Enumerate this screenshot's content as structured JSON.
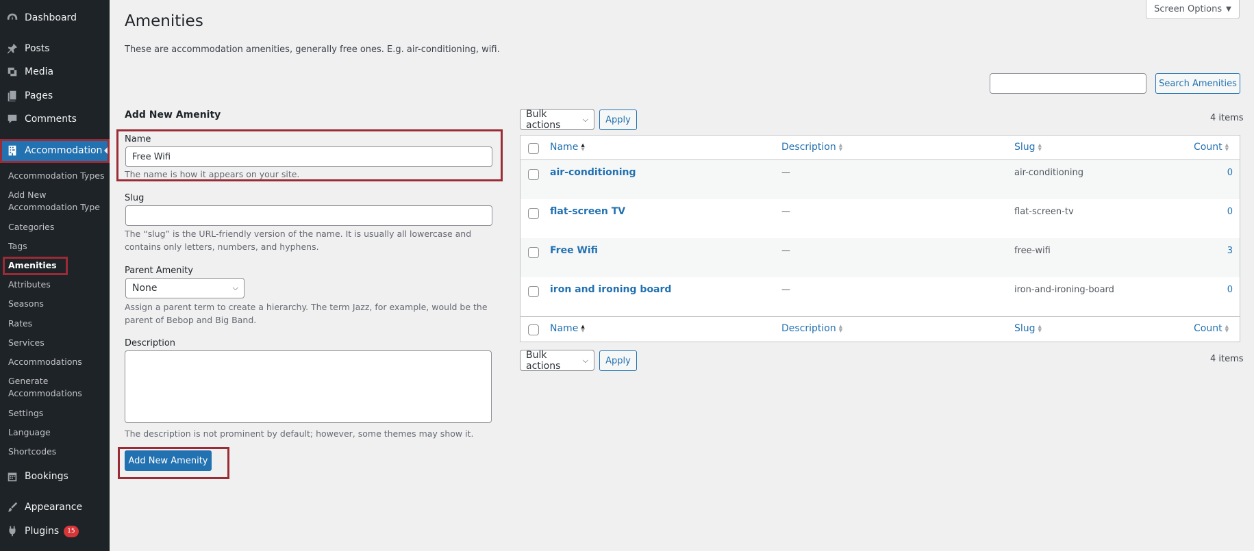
{
  "sidebar": {
    "menu": [
      {
        "label": "Dashboard",
        "icon": "dashboard-icon"
      },
      {
        "label": "Posts",
        "icon": "pin-icon"
      },
      {
        "label": "Media",
        "icon": "media-icon"
      },
      {
        "label": "Pages",
        "icon": "pages-icon"
      },
      {
        "label": "Comments",
        "icon": "comment-icon"
      },
      {
        "label": "Accommodation",
        "icon": "building-icon"
      }
    ],
    "submenu": [
      "Accommodation Types",
      "Add New\nAccommodation Type",
      "Categories",
      "Tags",
      "Amenities",
      "Attributes",
      "Seasons",
      "Rates",
      "Services",
      "Accommodations",
      "Generate\nAccommodations",
      "Settings",
      "Language",
      "Shortcodes"
    ],
    "bottom_menu": [
      {
        "label": "Bookings",
        "icon": "calendar-icon"
      },
      {
        "label": "Appearance",
        "icon": "brush-icon"
      },
      {
        "label": "Plugins",
        "icon": "plugin-icon",
        "badge": "15"
      }
    ]
  },
  "header": {
    "title": "Amenities",
    "description": "These are accommodation amenities, generally free ones. E.g. air-conditioning, wifi.",
    "screen_options": "Screen Options"
  },
  "search": {
    "value": "",
    "button": "Search Amenities"
  },
  "form": {
    "heading": "Add New Amenity",
    "name_label": "Name",
    "name_value": "Free Wifi",
    "name_help": "The name is how it appears on your site.",
    "slug_label": "Slug",
    "slug_value": "",
    "slug_help": "The “slug” is the URL-friendly version of the name. It is usually all lowercase and contains only letters, numbers, and hyphens.",
    "parent_label": "Parent Amenity",
    "parent_value": "None",
    "parent_help": "Assign a parent term to create a hierarchy. The term Jazz, for example, would be the parent of Bebop and Big Band.",
    "description_label": "Description",
    "description_value": "",
    "description_help": "The description is not prominent by default; however, some themes may show it.",
    "submit": "Add New Amenity"
  },
  "table": {
    "bulk_actions": "Bulk actions",
    "apply": "Apply",
    "items_count": "4 items",
    "columns": {
      "name": "Name",
      "description": "Description",
      "slug": "Slug",
      "count": "Count"
    },
    "rows": [
      {
        "name": "air-conditioning",
        "description": "—",
        "slug": "air-conditioning",
        "count": "0"
      },
      {
        "name": "flat-screen TV",
        "description": "—",
        "slug": "flat-screen-tv",
        "count": "0"
      },
      {
        "name": "Free Wifi",
        "description": "—",
        "slug": "free-wifi",
        "count": "3"
      },
      {
        "name": "iron and ironing board",
        "description": "—",
        "slug": "iron-and-ironing-board",
        "count": "0"
      }
    ]
  },
  "colors": {
    "accent": "#2271b1",
    "sidebar": "#1d2327",
    "highlight": "#9b2c35",
    "badge": "#d63638"
  }
}
